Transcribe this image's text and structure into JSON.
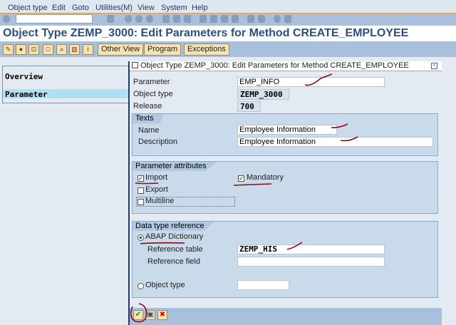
{
  "menu": [
    "Object type",
    "Edit",
    "Goto",
    "Utilities(M)",
    "View",
    "System",
    "Help"
  ],
  "page_title": "Object Type ZEMP_3000: Edit Parameters for Method CREATE_EMPLOYEE",
  "app_toolbar": {
    "other_view": "Other View",
    "program": "Program",
    "exceptions": "Exceptions"
  },
  "left_panel": {
    "overview": "Overview",
    "parameter": "Parameter"
  },
  "dialog": {
    "title": "Object Type ZEMP_3000: Edit Parameters for Method CREATE_EMPLOYEE",
    "parameter_label": "Parameter",
    "parameter_value": "EMP_INFO",
    "object_type_label": "Object type",
    "object_type_value": "ZEMP_3000",
    "release_label": "Release",
    "release_value": "700",
    "texts": {
      "header": "Texts",
      "name_label": "Name",
      "name_value": "Employee Information",
      "description_label": "Description",
      "description_value": "Employee Information"
    },
    "attributes": {
      "header": "Parameter attributes",
      "import": "Import",
      "import_checked": true,
      "export": "Export",
      "export_checked": false,
      "multiline": "Multiline",
      "multiline_checked": false,
      "mandatory": "Mandatory",
      "mandatory_checked": true
    },
    "data_type": {
      "header": "Data type reference",
      "abap_dictionary": "ABAP Dictionary",
      "reference_table_label": "Reference table",
      "reference_table_value": "ZEMP_HIS",
      "reference_field_label": "Reference field",
      "reference_field_value": "",
      "object_type": "Object type",
      "object_type_value": ""
    }
  }
}
